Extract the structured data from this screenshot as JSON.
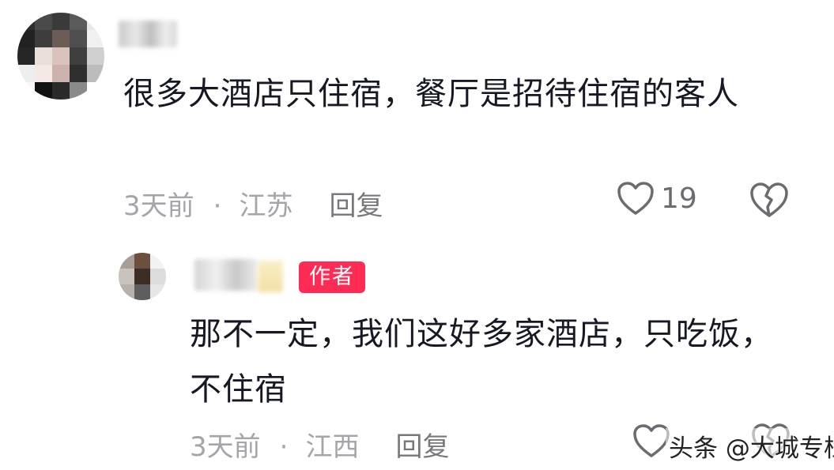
{
  "comment": {
    "text": "很多大酒店只住宿，餐厅是招待住宿的客人",
    "time": "3天前",
    "separator": "·",
    "location": "江苏",
    "reply_label": "回复",
    "like_count": "19",
    "like_icon": "heart-outline-icon",
    "dislike_icon": "broken-heart-icon"
  },
  "reply": {
    "badge": "作者",
    "text": "那不一定，我们这好多家酒店，只吃饭，不住宿",
    "time": "3天前",
    "separator": "·",
    "location": "江西",
    "reply_label": "回复",
    "like_icon": "heart-outline-icon",
    "dislike_icon": "broken-heart-icon"
  },
  "watermark": "头条 @大城专栏",
  "colors": {
    "text": "#161823",
    "meta": "#a4a5aa",
    "reply_link": "#77787d",
    "icon": "#6b6c71",
    "badge_bg": "#fe2c55",
    "badge_text": "#ffffff"
  }
}
